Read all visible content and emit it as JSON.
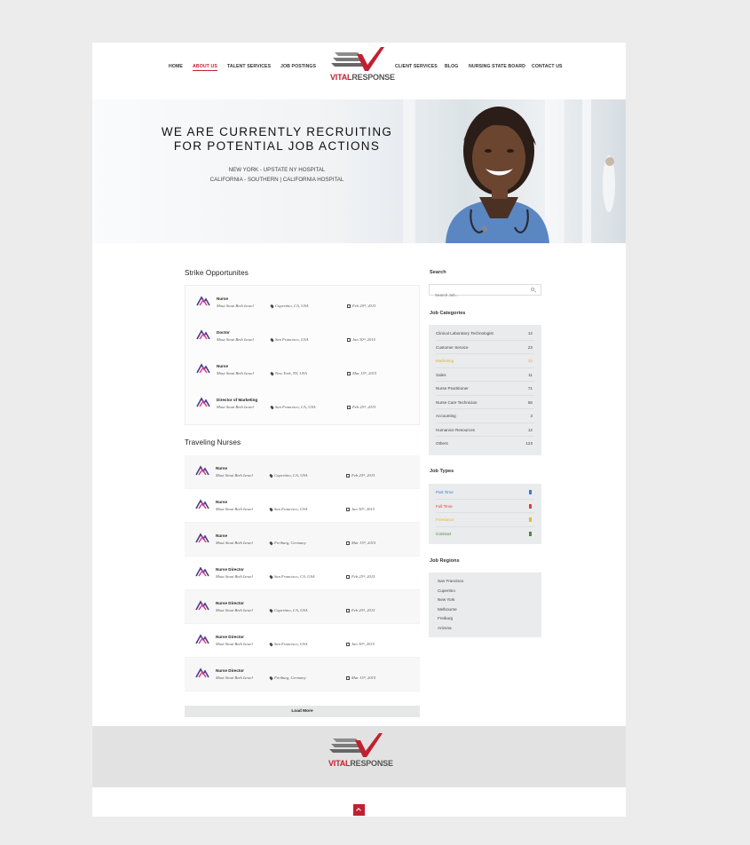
{
  "nav": {
    "left": [
      "HOME",
      "ABOUT US",
      "TALENT SERVICES",
      "JOB POSTINGS"
    ],
    "right": [
      "CLIENT SERVICES",
      "BLOG",
      "NURSING STATE BOARD",
      "CONTACT US"
    ],
    "active": "ABOUT US"
  },
  "logo": {
    "part1": "VITAL",
    "part2": "RESPONSE"
  },
  "hero": {
    "title_line1": "WE ARE CURRENTLY RECRUITING",
    "title_line2": "FOR POTENTIAL JOB ACTIONS",
    "sub_line1": "NEW YORK -  UPSTATE NY HOSPITAL",
    "sub_line2": "CALIFORNIA - SOUTHERN | CALIFORNIA HOSPITAL"
  },
  "strike": {
    "heading": "Strike Opportunites",
    "jobs": [
      {
        "title": "Nurse",
        "company": "Mout Sinai Beth Israel",
        "location": "Cupertino, CA, USA",
        "date": "Feb 20ᵗʰ, 2015"
      },
      {
        "title": "Doctor",
        "company": "Mout Sinai Beth Israel",
        "location": "San Francisco, USA",
        "date": "Jan 30ᵗʰ, 2015"
      },
      {
        "title": "Nurse",
        "company": "Mout Sinai Beth Israel",
        "location": "New York, NY, USA",
        "date": "Mar 15ᵗʰ, 2015"
      },
      {
        "title": "Director of Marketing",
        "company": "Mout Sinai Beth Israel",
        "location": "San Francisco, CA, USA",
        "date": "Feb 25ᵗʰ, 2015"
      }
    ]
  },
  "traveling": {
    "heading": "Traveling Nurses",
    "jobs": [
      {
        "title": "Nurse",
        "company": "Mout Sinai Beth Israel",
        "location": "Cupertino, CA, USA",
        "date": "Feb 20ᵗʰ, 2015"
      },
      {
        "title": "Nurse",
        "company": "Mout Sinai Beth Israel",
        "location": "San Francisco, USA",
        "date": "Jan 30ᵗʰ, 2015"
      },
      {
        "title": "Nurse",
        "company": "Mout Sinai Beth Israel",
        "location": "Freiburg, Germany",
        "date": "Mar 15ᵗʰ, 2015"
      },
      {
        "title": "Nurse Director",
        "company": "Mout Sinai Beth Israel",
        "location": "San Francisco, CA, USA",
        "date": "Feb 25ᵗʰ, 2015"
      },
      {
        "title": "Nurse Director",
        "company": "Mout Sinai Beth Israel",
        "location": "Cupertino, CA, USA",
        "date": "Feb 20ᵗʰ, 2015"
      },
      {
        "title": "Nurse Director",
        "company": "Mout Sinai Beth Israel",
        "location": "San Francisco, USA",
        "date": "Jan 30ᵗʰ, 2015"
      },
      {
        "title": "Nurse Director",
        "company": "Mout Sinai Beth Israel",
        "location": "Freiburg, Germany",
        "date": "Mar 15ᵗʰ, 2015"
      }
    ],
    "load_more": "Load More"
  },
  "sidebar": {
    "search_heading": "Search",
    "search_placeholder": "Search Job...",
    "categories_heading": "Job Categories",
    "categories": [
      {
        "name": "Clinical Laboratory Technologist",
        "count": "12"
      },
      {
        "name": "Customer Service",
        "count": "23"
      },
      {
        "name": "Marketing",
        "count": "32",
        "highlight": true
      },
      {
        "name": "Sales",
        "count": "11"
      },
      {
        "name": "Nurse Practitioner",
        "count": "71"
      },
      {
        "name": "Nurse Care Technician",
        "count": "56"
      },
      {
        "name": "Accounting",
        "count": "3"
      },
      {
        "name": "Humanice Resources",
        "count": "12"
      },
      {
        "name": "Others",
        "count": "123"
      }
    ],
    "types_heading": "Job Types",
    "types": [
      {
        "name": "Part Time",
        "color": "#3a7bd5"
      },
      {
        "name": "Full Time",
        "color": "#e0403a"
      },
      {
        "name": "Freelance",
        "color": "#e8b53a"
      },
      {
        "name": "Contract",
        "color": "#4c8a3a"
      }
    ],
    "regions_heading": "Job Regions",
    "regions": [
      "San Francisco",
      "Cupertino",
      "New York",
      "Melbourne",
      "Freiburg",
      "Arizona"
    ]
  },
  "colors": {
    "brand": "#c12030",
    "panel": "#e9ebec"
  }
}
